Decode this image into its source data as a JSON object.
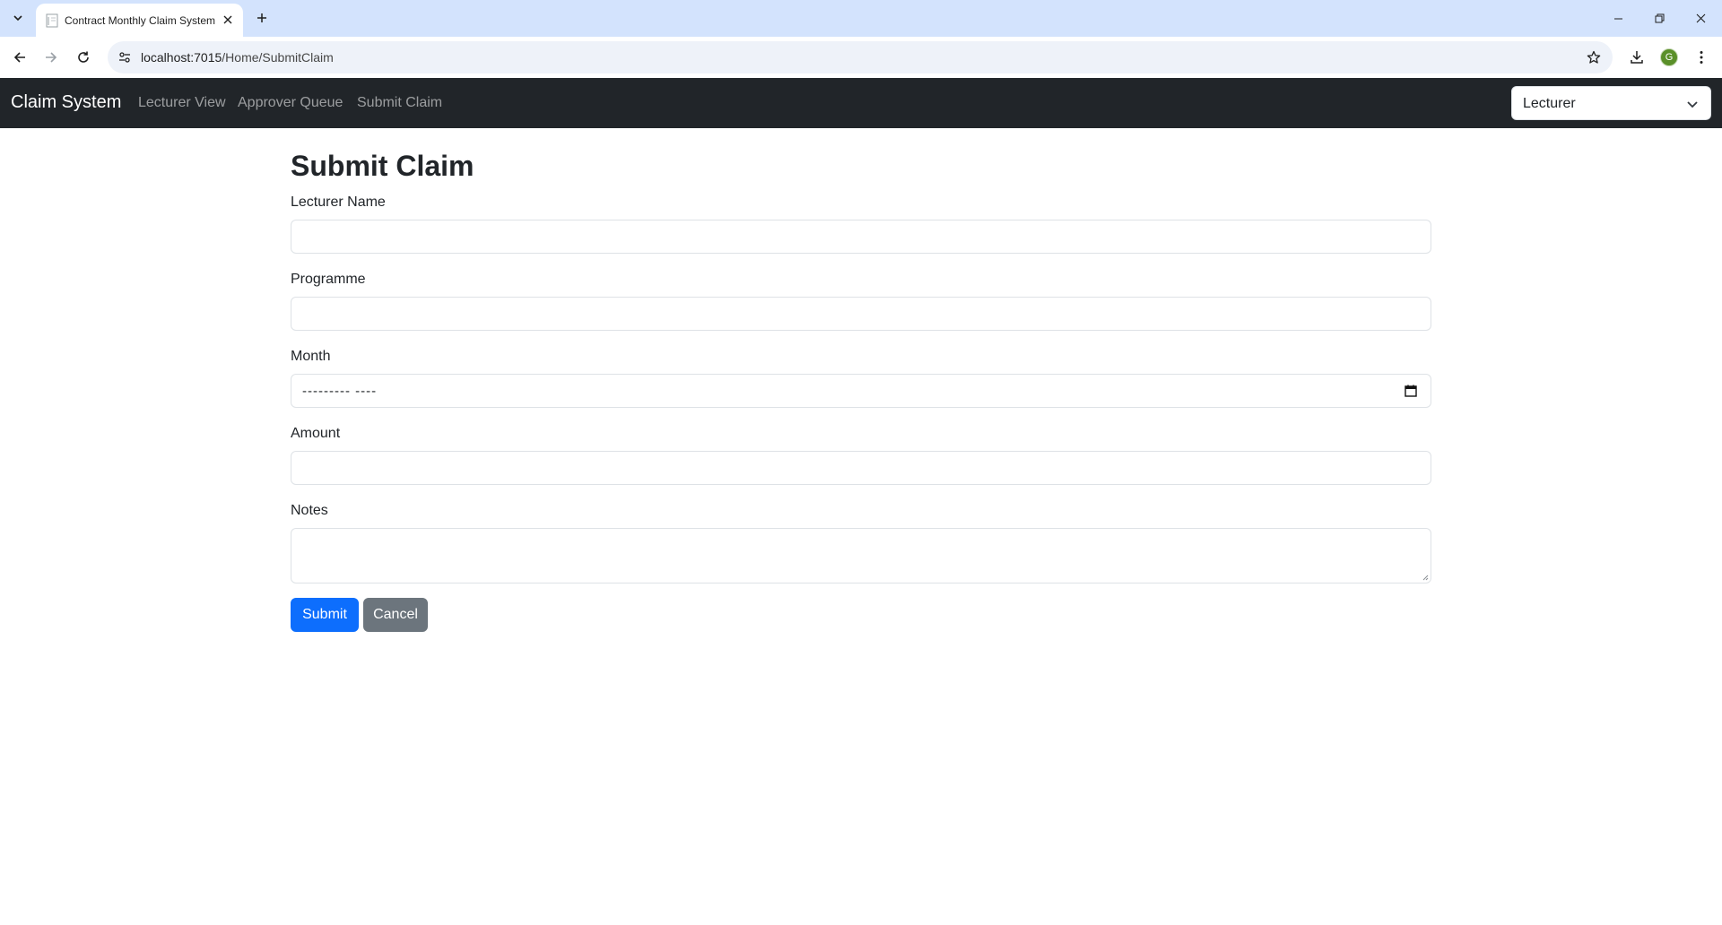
{
  "browser": {
    "tab_title": "Contract Monthly Claim System",
    "url_host": "localhost:7015",
    "url_path": "/Home/SubmitClaim",
    "profile_initial": "G",
    "profile_color": "#5a8f29"
  },
  "navbar": {
    "brand": "Claim System",
    "links": [
      "Lecturer View",
      "Approver Queue",
      "Submit Claim"
    ],
    "role_selected": "Lecturer",
    "background": "#212529"
  },
  "form": {
    "title": "Submit Claim",
    "lecturer_name_label": "Lecturer Name",
    "lecturer_name_value": "",
    "programme_label": "Programme",
    "programme_value": "",
    "month_label": "Month",
    "month_placeholder": "--------- ----",
    "amount_label": "Amount",
    "amount_value": "",
    "notes_label": "Notes",
    "notes_value": "",
    "submit_label": "Submit",
    "cancel_label": "Cancel"
  },
  "colors": {
    "primary": "#0d6efd",
    "secondary": "#6c757d",
    "tabstrip": "#d3e3fd"
  }
}
